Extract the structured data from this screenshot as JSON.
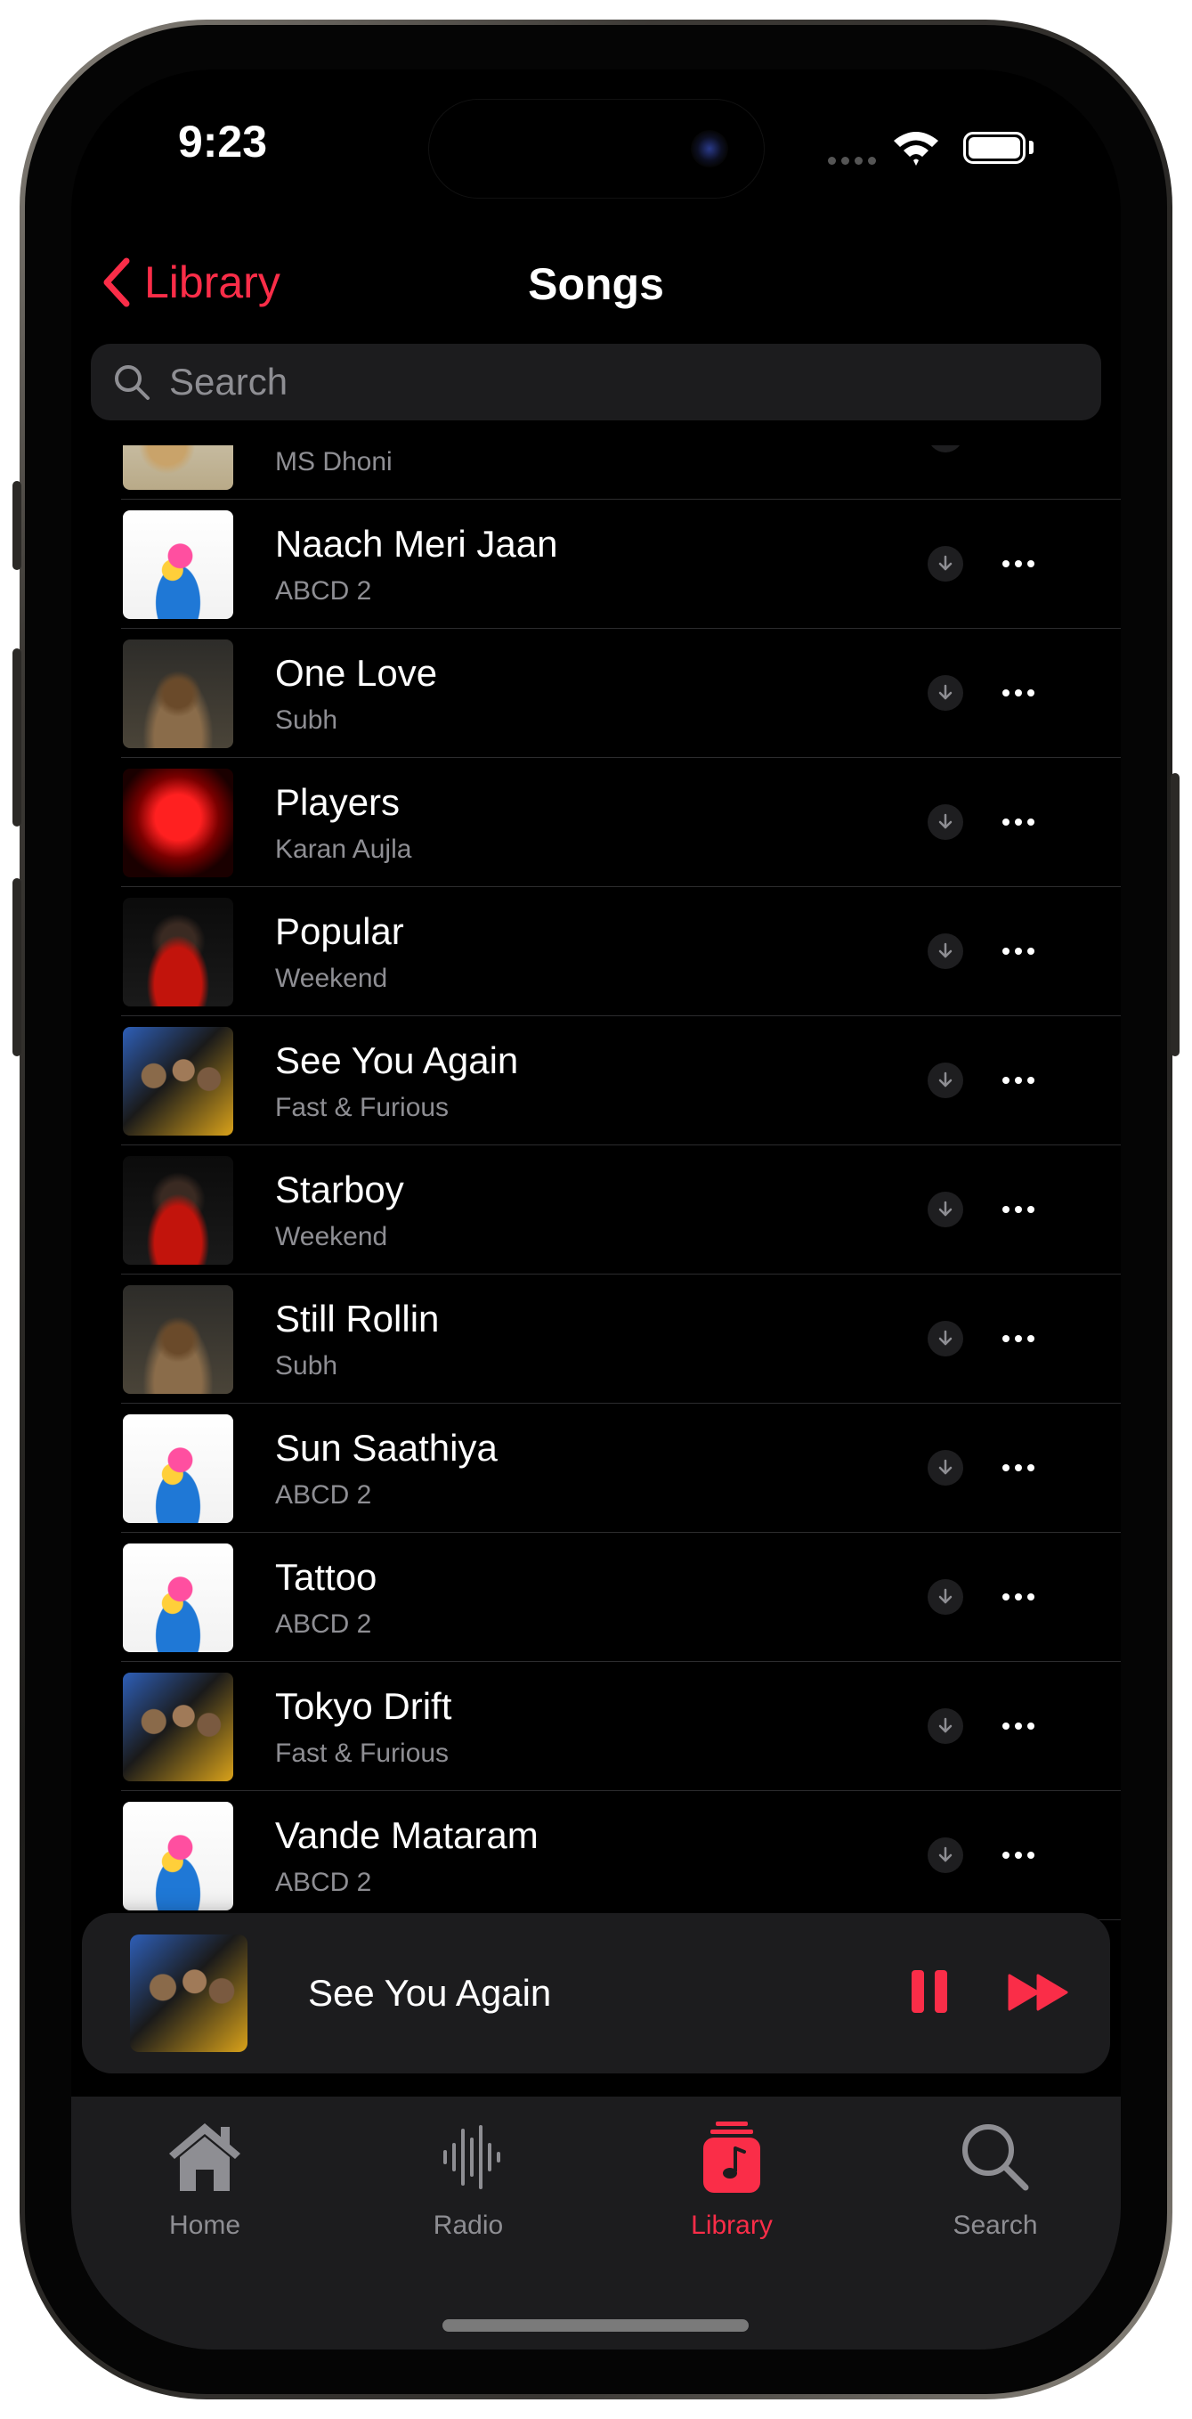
{
  "status_bar": {
    "time": "9:23"
  },
  "nav": {
    "back_label": "Library",
    "title": "Songs"
  },
  "search": {
    "placeholder": "Search"
  },
  "songs": [
    {
      "title": "",
      "artist": "MS Dhoni",
      "art": "art-dhoni"
    },
    {
      "title": "Naach Meri Jaan",
      "artist": "ABCD 2",
      "art": "art-abcd"
    },
    {
      "title": "One Love",
      "artist": "Subh",
      "art": "art-subh"
    },
    {
      "title": "Players",
      "artist": "Karan Aujla",
      "art": "art-karan"
    },
    {
      "title": "Popular",
      "artist": "Weekend",
      "art": "art-weekend"
    },
    {
      "title": "See You Again",
      "artist": "Fast & Furious",
      "art": "art-ff"
    },
    {
      "title": "Starboy",
      "artist": "Weekend",
      "art": "art-weekend"
    },
    {
      "title": "Still Rollin",
      "artist": "Subh",
      "art": "art-subh"
    },
    {
      "title": "Sun Saathiya",
      "artist": "ABCD 2",
      "art": "art-abcd"
    },
    {
      "title": "Tattoo",
      "artist": "ABCD 2",
      "art": "art-abcd"
    },
    {
      "title": "Tokyo Drift",
      "artist": "Fast & Furious",
      "art": "art-ff"
    },
    {
      "title": "Vande Mataram",
      "artist": "ABCD 2",
      "art": "art-abcd"
    }
  ],
  "now_playing": {
    "title": "See You Again",
    "art": "art-ff"
  },
  "tabs": [
    {
      "label": "Home",
      "icon": "home-icon",
      "active": false
    },
    {
      "label": "Radio",
      "icon": "radio-icon",
      "active": false
    },
    {
      "label": "Library",
      "icon": "library-icon",
      "active": true
    },
    {
      "label": "Search",
      "icon": "search-icon",
      "active": false
    }
  ],
  "colors": {
    "accent": "#fa2d48",
    "background": "#000000",
    "secondary_text": "#8e8e93",
    "surface": "#1c1c1e"
  }
}
